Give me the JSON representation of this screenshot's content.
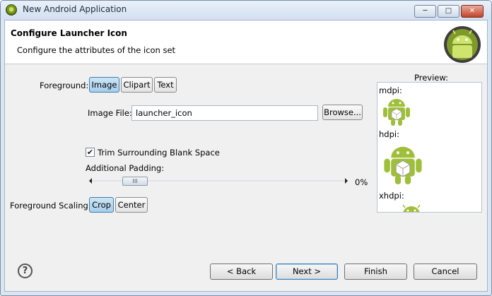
{
  "window": {
    "title": "New Android Application"
  },
  "window_controls": {
    "minimize": "─",
    "maximize": "□",
    "close": "✕"
  },
  "banner": {
    "title": "Configure Launcher Icon",
    "subtitle": "Configure the attributes of the icon set"
  },
  "foreground": {
    "label": "Foreground:",
    "options": [
      "Image",
      "Clipart",
      "Text"
    ],
    "selected": "Image"
  },
  "image_file": {
    "label": "Image File:",
    "value": "launcher_icon",
    "browse_label": "Browse..."
  },
  "trim": {
    "label": "Trim Surrounding Blank Space",
    "checked": true,
    "mark": "✔"
  },
  "padding": {
    "label": "Additional Padding:",
    "value_text": "0%",
    "value": 0,
    "thumb_grip": "III"
  },
  "scaling": {
    "label": "Foreground Scaling:",
    "options": [
      "Crop",
      "Center"
    ],
    "selected": "Crop"
  },
  "preview": {
    "label": "Preview:",
    "densities": [
      "mdpi:",
      "hdpi:",
      "xhdpi:"
    ]
  },
  "footer": {
    "help": "?",
    "back": "< Back",
    "next": "Next >",
    "finish": "Finish",
    "cancel": "Cancel"
  },
  "colors": {
    "android_green": "#9fbf3b",
    "selected_blue": "#a7cdea"
  }
}
